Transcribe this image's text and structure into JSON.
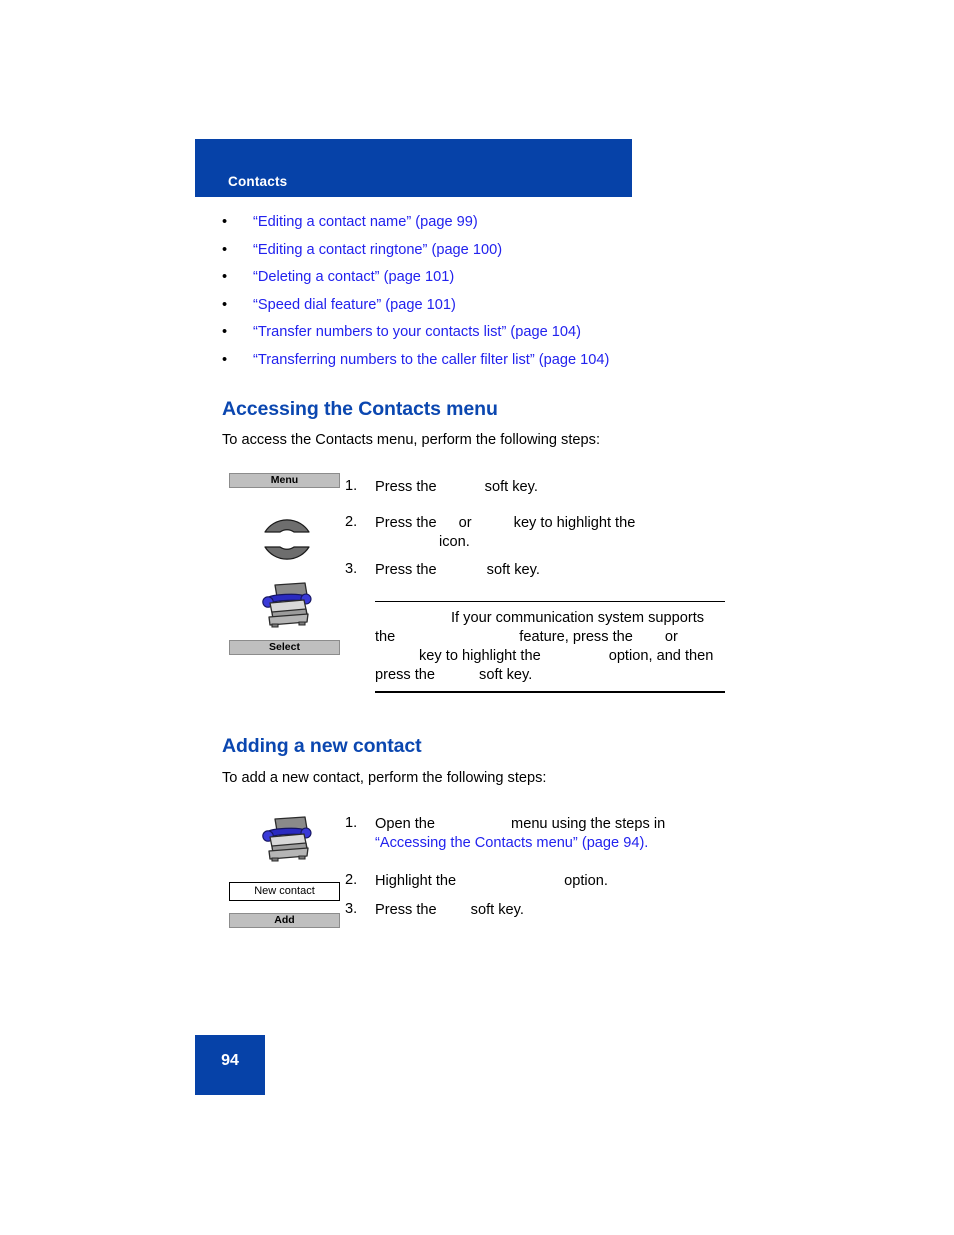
{
  "header": {
    "chapter_title": "Contacts",
    "band_color": "#0642A8"
  },
  "links": [
    {
      "label": "“Editing a contact name” (page 99)"
    },
    {
      "label": "“Editing a contact ringtone” (page 100)"
    },
    {
      "label": "“Deleting a contact” (page 101)"
    },
    {
      "label": "“Speed dial feature” (page 101)"
    },
    {
      "label": "“Transfer numbers to your contacts list” (page 104)"
    },
    {
      "label": "“Transferring numbers to the caller filter list” (page 104)"
    }
  ],
  "bullet_char": "•",
  "section_one": {
    "heading": "Accessing the Contacts menu",
    "intro": "To access the Contacts menu, perform the following steps:",
    "steps": [
      {
        "num": "1.",
        "text_a": "Press the",
        "text_b": "soft key."
      },
      {
        "num": "2.",
        "text_a": "Press the",
        "text_b": "or",
        "text_c": "key to highlight the",
        "text_d": "icon."
      },
      {
        "num": "3.",
        "text_a": "Press the",
        "text_b": "soft key."
      }
    ],
    "art": {
      "menu_softkey": "Menu",
      "select_softkey": "Select",
      "nav_up_icon": "navigation-up-key-icon",
      "nav_down_icon": "navigation-down-key-icon",
      "contacts_icon": "contacts-rolodex-icon"
    },
    "note": {
      "line_1": "If your communication system supports",
      "line_2_a": "the",
      "line_2_b": "feature, press the",
      "line_2_c": "or",
      "line_3_a": "key to highlight the",
      "line_3_b": "option, and then",
      "line_4_a": "press the",
      "line_4_b": "soft key."
    }
  },
  "section_two": {
    "heading": "Adding a new contact",
    "intro": "To add a new contact, perform the following steps:",
    "steps": [
      {
        "num": "1.",
        "text_a": "Open the",
        "text_b": "menu using the steps in",
        "xref": "“Accessing the Contacts menu” (page 94)."
      },
      {
        "num": "2.",
        "text_a": "Highlight the",
        "text_b": "option."
      },
      {
        "num": "3.",
        "text_a": "Press the",
        "text_b": "soft key."
      }
    ],
    "art": {
      "contacts_icon": "contacts-rolodex-icon",
      "new_contact_box": "New contact",
      "add_softkey": "Add"
    }
  },
  "footer": {
    "page_number": "94",
    "badge_color": "#0642A8"
  },
  "colors": {
    "brand_blue": "#0642A8",
    "heading_blue": "#0B47B0",
    "link_blue": "#2222EE",
    "softkey_gray": "#BFBFBF"
  }
}
